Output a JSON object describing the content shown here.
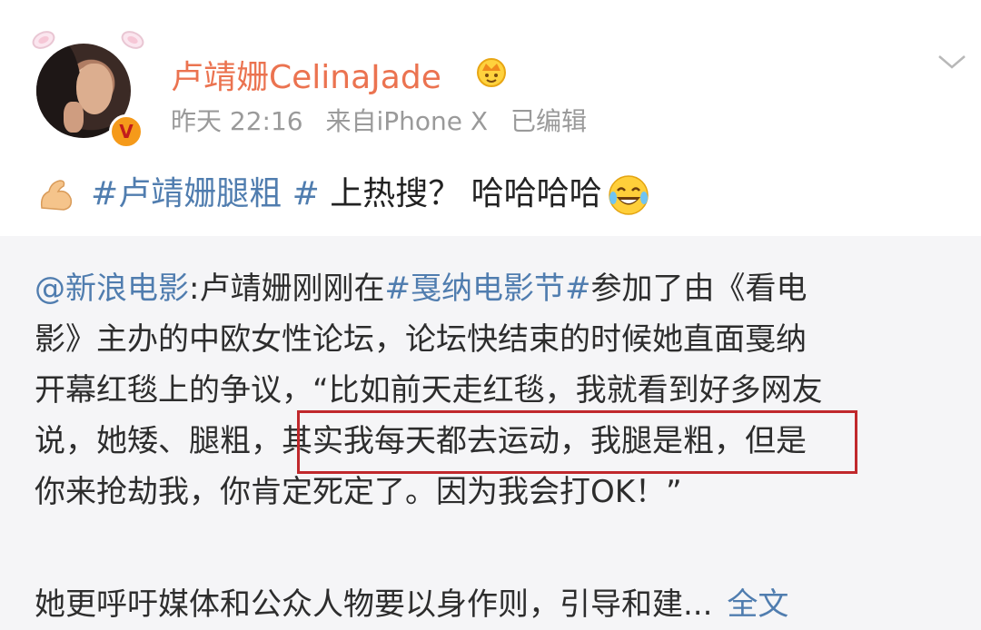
{
  "post": {
    "username": "卢靖姗CelinaJade",
    "verified_badge": "V",
    "time": "昨天 22:16",
    "source": "来自iPhone X",
    "edited": "已编辑",
    "topic": "#卢靖姗腿粗 #",
    "text": "上热搜？ 哈哈哈哈",
    "icons": [
      "bunny-ears-icon",
      "crown-icon",
      "muscle-emoji-icon",
      "laugh-emoji-icon",
      "chevron-down-icon"
    ]
  },
  "repost": {
    "mention": "@新浪电影",
    "line1_part1": ":卢靖姗刚刚在",
    "topic": "#戛纳电影节#",
    "line1_part2": "参加了由《看电",
    "line2": "影》主办的中欧女性论坛，论坛快结束的时候她直面戛纳",
    "line3": "开幕红毯上的争议，“比如前天走红毯，我就看到好多网友",
    "line4": "说，她矮、腿粗，其实我每天都去运动，我腿是粗，但是",
    "line5": "你来抢劫我，你肯定死定了。因为我会打OK！”",
    "more_text": "她更呼吁媒体和公众人物要以身作则，引导和建...",
    "full_text_link": "全文"
  },
  "colors": {
    "username": "#eb7350",
    "link": "#507daf",
    "highlight": "#c0282c",
    "repost_bg": "#f5f5f7"
  }
}
